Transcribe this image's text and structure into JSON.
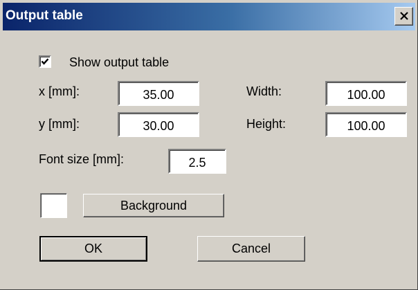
{
  "dialog": {
    "title": "Output table",
    "show_output_table": {
      "label": "Show output table",
      "checked": true
    },
    "x": {
      "label": "x [mm]:",
      "value": "35.00"
    },
    "y": {
      "label": "y [mm]:",
      "value": "30.00"
    },
    "width": {
      "label": "Width:",
      "value": "100.00"
    },
    "height": {
      "label": "Height:",
      "value": "100.00"
    },
    "font_size": {
      "label": "Font size [mm]:",
      "value": "2.5"
    },
    "background": {
      "label": "Background",
      "color": "#ffffff"
    },
    "ok_label": "OK",
    "cancel_label": "Cancel"
  }
}
